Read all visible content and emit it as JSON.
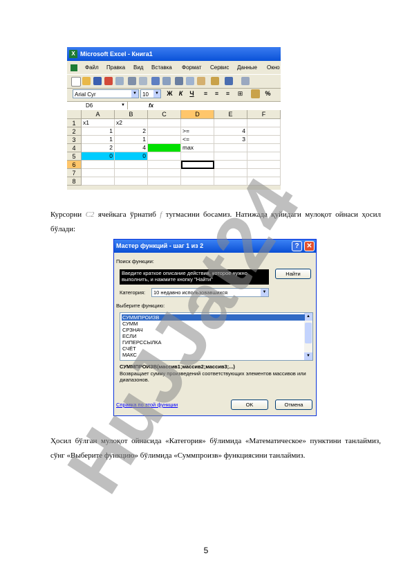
{
  "excel": {
    "title": "Microsoft Excel - Книга1",
    "menu": [
      "Файл",
      "Правка",
      "Вид",
      "Вставка",
      "Формат",
      "Сервис",
      "Данные",
      "Окно"
    ],
    "font_name": "Arial Cyr",
    "font_size": "10",
    "format_buttons": [
      "Ж",
      "К",
      "Ч"
    ],
    "percent": "%",
    "name_box": "D6",
    "fx": "fx",
    "columns": [
      "A",
      "B",
      "C",
      "D",
      "E",
      "F"
    ],
    "rows": [
      "1",
      "2",
      "3",
      "4",
      "5",
      "6",
      "7",
      "8"
    ],
    "cells": {
      "A1": "x1",
      "B1": "x2",
      "A2": "1",
      "B2": "2",
      "D2": ">=",
      "E2": "4",
      "A3": "1",
      "B3": "1",
      "D3": "<=",
      "E3": "3",
      "A4": "2",
      "B4": "4",
      "D4": "max",
      "A5": "0",
      "B5": "0"
    },
    "colors": {
      "green_cell": "#00e000",
      "cyan_cells": "#00ccff",
      "selected_header": "#ffc66b"
    }
  },
  "paragraph1": {
    "before": "Курсорни ",
    "cell_ref": "C2",
    "middle": " ячейкага ўрнатиб ",
    "icon_ref": "f",
    "after": " тугмасини босамиз. Натижада қуйидаги мулоқот ойнаси ҳосил бўлади:"
  },
  "dialog": {
    "title": "Мастер функций - шаг 1 из 2",
    "search_label": "Поиск функции:",
    "search_text": "Введите краткое описание действия, которое нужно выполнить, и нажмите кнопку \"Найти\"",
    "find_button": "Найти",
    "category_label": "Категория:",
    "category_value": "10 недавно использовавшихся",
    "select_label": "Выберите функцию:",
    "functions": [
      "СУММПРОИЗВ",
      "СУММ",
      "СРЗНАЧ",
      "ЕСЛИ",
      "ГИПЕРССЫЛКА",
      "СЧЁТ",
      "МАКС"
    ],
    "syntax": "СУММПРОИЗВ(массив1;массив2;массив3;...)",
    "description": "Возвращает сумму произведений соответствующих элементов массивов или диапазонов.",
    "help_link": "Справка по этой функции",
    "ok_button": "OK",
    "cancel_button": "Отмена",
    "help_glyph": "?",
    "close_glyph": "✕"
  },
  "paragraph2": "Ҳосил бўлган мулоқот ойнасида «Категория» бўлимида «Математическое» пунктини танлаймиз, сўнг «Выберите функцию» бўлимида «Суммпроизв» функциясини танлаймиз.",
  "watermark": "HuJJat24",
  "page_number": "5"
}
